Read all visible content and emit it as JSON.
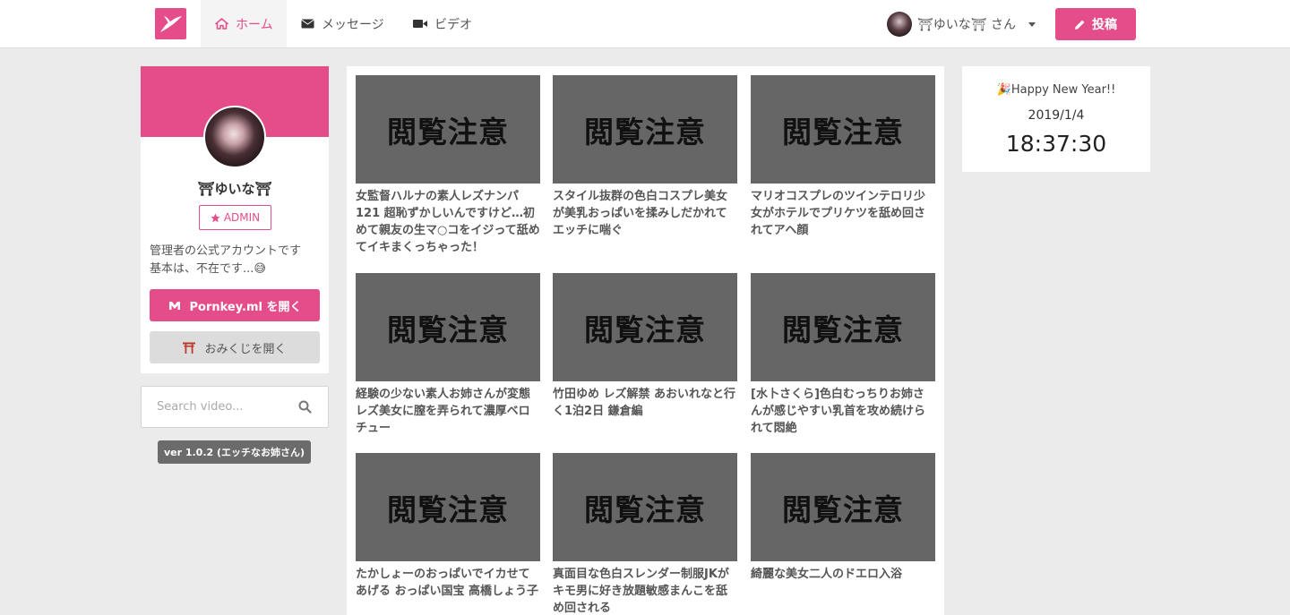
{
  "nav": {
    "home": "ホーム",
    "messages": "メッセージ",
    "video": "ビデオ",
    "user": "⛩ゆいな⛩ さん",
    "post": "投稿"
  },
  "profile": {
    "name": "⛩ゆいな⛩",
    "badge": "ADMIN",
    "desc_line1": "管理者の公式アカウントです",
    "desc_line2": "基本は、不在です...😅",
    "open_button": "Pornkey.ml を開く",
    "omikuji_button": "おみくじを開く"
  },
  "search": {
    "placeholder": "Search video..."
  },
  "version": "ver 1.0.2 (エッチなお姉さん)",
  "widget": {
    "greeting": "🎉Happy New Year!!",
    "date": "2019/1/4",
    "time": "18:37:30"
  },
  "videos": [
    {
      "thumb": "閲覧注意",
      "title": "女監督ハルナの素人レズナンパ121 超恥ずかしいんですけど…初めて親友の生マ○コをイジって舐めてイキまくっちゃった！"
    },
    {
      "thumb": "閲覧注意",
      "title": "スタイル抜群の色白コスプレ美女が美乳おっぱいを揉みしだかれてエッチに喘ぐ"
    },
    {
      "thumb": "閲覧注意",
      "title": "マリオコスプレのツインテロリ少女がホテルでプリケツを舐め回されてアヘ顔"
    },
    {
      "thumb": "閲覧注意",
      "title": "経験の少ない素人お姉さんが変態レズ美女に膣を弄られて濃厚ベロチュー"
    },
    {
      "thumb": "閲覧注意",
      "title": "竹田ゆめ レズ解禁 あおいれなと行く1泊2日 鎌倉編"
    },
    {
      "thumb": "閲覧注意",
      "title": "[水卜さくら]色白むっちりお姉さんが感じやすい乳首を攻め続けられて悶絶"
    },
    {
      "thumb": "閲覧注意",
      "title": "たかしょーのおっぱいでイカせてあげる おっぱい国宝 高橋しょう子"
    },
    {
      "thumb": "閲覧注意",
      "title": "真面目な色白スレンダー制服JKがキモ男に好き放題敏感まんこを舐め回される"
    },
    {
      "thumb": "閲覧注意",
      "title": "綺麗な美女二人のドエロ入浴"
    }
  ],
  "colors": {
    "accent": "#e44c8a",
    "thumb": "#666666",
    "background": "#ebebeb"
  }
}
